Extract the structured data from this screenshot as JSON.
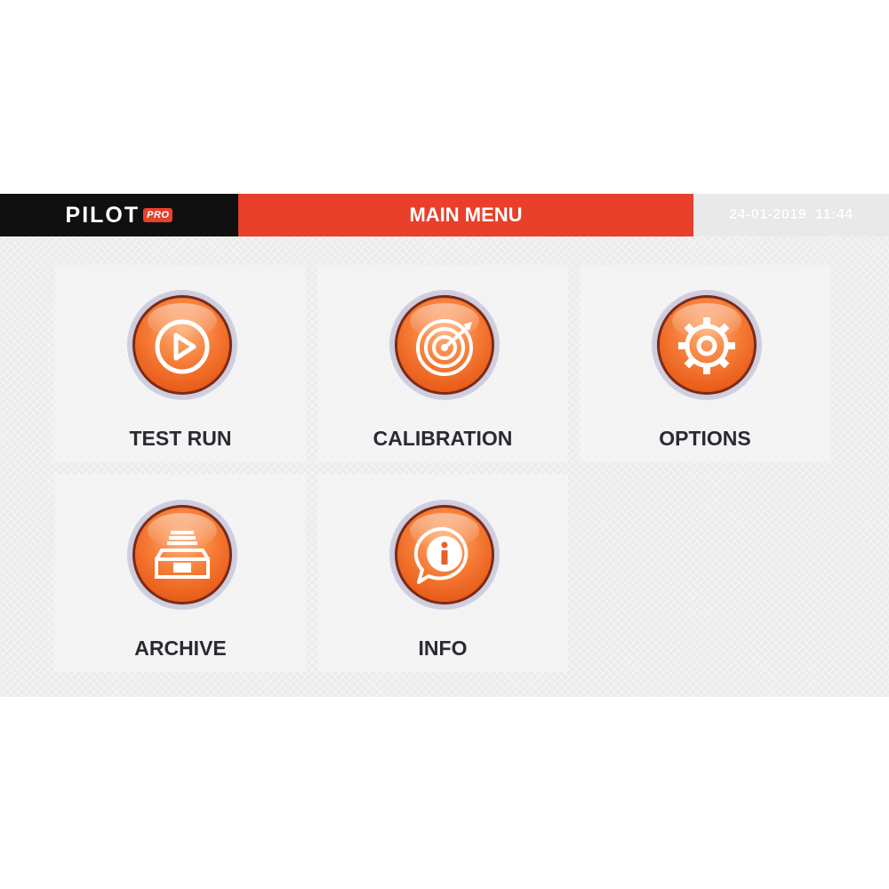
{
  "header": {
    "brand_name": "PILOT",
    "brand_badge": "PRO",
    "title": "MAIN MENU",
    "date": "24-01-2019",
    "time": "11:44"
  },
  "menu": {
    "items": [
      {
        "label": "TEST RUN",
        "icon": "play-icon"
      },
      {
        "label": "CALIBRATION",
        "icon": "target-icon"
      },
      {
        "label": "OPTIONS",
        "icon": "gear-icon"
      },
      {
        "label": "ARCHIVE",
        "icon": "drawer-icon"
      },
      {
        "label": "INFO",
        "icon": "info-icon"
      }
    ]
  },
  "colors": {
    "header_accent": "#e8402a",
    "brand_background": "#101010",
    "button_orange": "#f47a34",
    "label_text": "#2a2a33"
  }
}
